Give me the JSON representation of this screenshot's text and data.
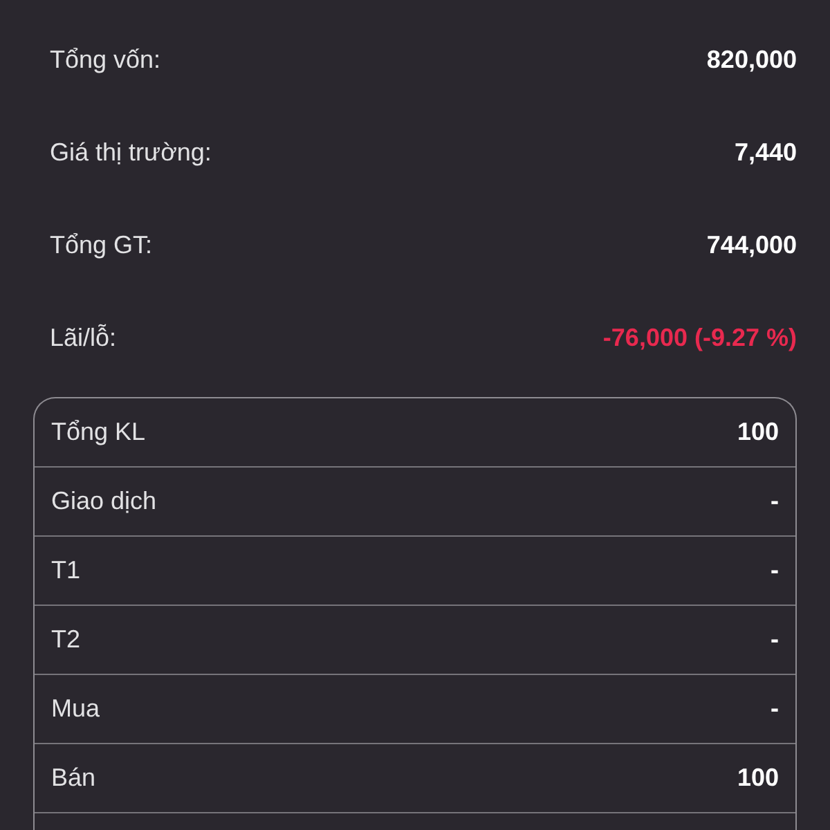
{
  "summary": [
    {
      "label": "Tổng vốn:",
      "value": "820,000",
      "color": "#ffffff"
    },
    {
      "label": "Giá thị trường:",
      "value": "7,440",
      "color": "#ffffff"
    },
    {
      "label": "Tổng GT:",
      "value": "744,000",
      "color": "#ffffff"
    },
    {
      "label": "Lãi/lỗ:",
      "value": "-76,000 (-9.27 %)",
      "color": "#e8294f"
    }
  ],
  "table": {
    "rows": [
      {
        "label": "Tổng KL",
        "value": "100"
      },
      {
        "label": "Giao dịch",
        "value": "-"
      },
      {
        "label": "T1",
        "value": "-"
      },
      {
        "label": "T2",
        "value": "-"
      },
      {
        "label": "Mua",
        "value": "-"
      },
      {
        "label": "Bán",
        "value": "100"
      }
    ]
  }
}
